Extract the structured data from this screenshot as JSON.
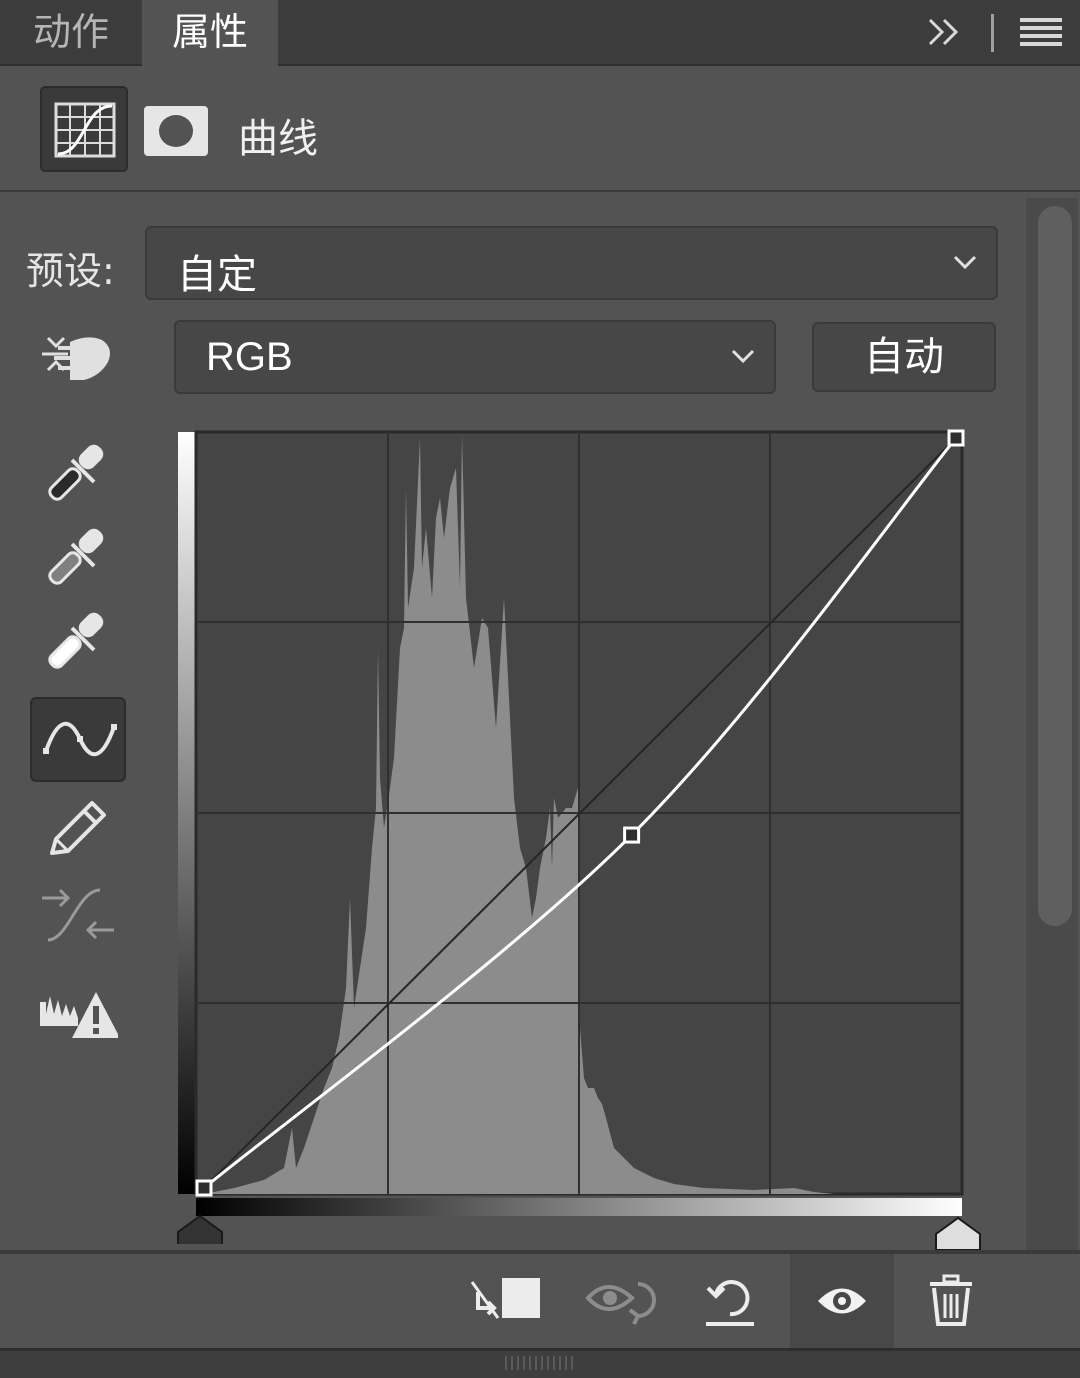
{
  "tabs": [
    {
      "label": "动作",
      "active": false
    },
    {
      "label": "属性",
      "active": true
    }
  ],
  "header": {
    "title": "曲线"
  },
  "preset": {
    "label": "预设:",
    "value": "自定"
  },
  "channel": {
    "value": "RGB"
  },
  "auto_button": {
    "label": "自动"
  },
  "tools": [
    "targeted-adjustment-icon",
    "black-eyedropper-icon",
    "gray-eyedropper-icon",
    "white-eyedropper-icon",
    "curve-edit-icon",
    "pencil-icon",
    "smooth-icon",
    "clipping-warning-icon"
  ],
  "bottom_actions": [
    "clip-to-layer-icon",
    "view-previous-icon",
    "reset-icon",
    "visibility-eye-icon",
    "trash-icon"
  ],
  "curve": {
    "points": [
      [
        0,
        0
      ],
      [
        145,
        120
      ],
      [
        255,
        255
      ]
    ],
    "selected_tool": "curve-edit"
  },
  "colors": {
    "panel_bg": "#535353",
    "graph_bg": "#454545",
    "histogram": "#8c8c8c",
    "curve": "#ffffff"
  }
}
